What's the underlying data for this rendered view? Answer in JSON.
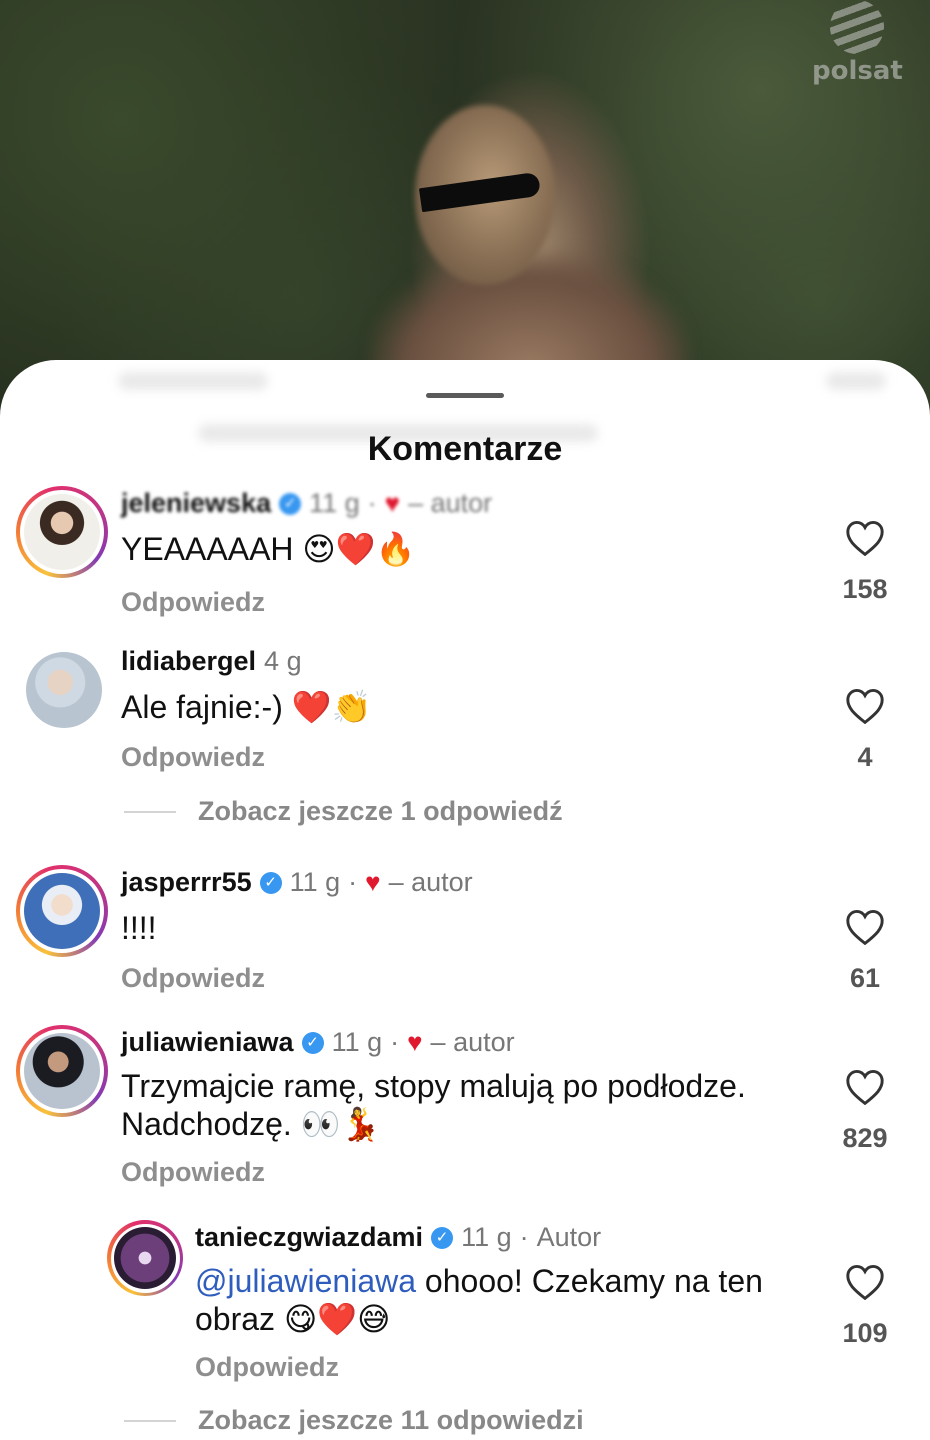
{
  "background": {
    "logo_text": "polsat"
  },
  "sheet": {
    "title": "Komentarze"
  },
  "comments": [
    {
      "username": "jeleniewska",
      "verified": true,
      "time": "11 g",
      "separator": "·",
      "author_tag": "– autor",
      "text": "YEAAAAAH",
      "emojis": "😍❤️🔥",
      "reply_label": "Odpowiedz",
      "likes": "158"
    },
    {
      "username": "lidiabergel",
      "verified": false,
      "time": "4 g",
      "text": "Ale fajnie:-)",
      "emojis": "❤️👏",
      "reply_label": "Odpowiedz",
      "likes": "4",
      "more_replies": "Zobacz jeszcze 1 odpowiedź"
    },
    {
      "username": "jasperrr55",
      "verified": true,
      "time": "11 g",
      "separator": "·",
      "author_tag": "– autor",
      "text": "!!!!",
      "reply_label": "Odpowiedz",
      "likes": "61"
    },
    {
      "username": "juliawieniawa",
      "verified": true,
      "time": "11 g",
      "separator": "·",
      "author_tag": "– autor",
      "text_line1": "Trzymajcie ramę, stopy malują po podłodze.",
      "text_line2": "Nadchodzę.",
      "emojis": "👀💃",
      "reply_label": "Odpowiedz",
      "likes": "829"
    },
    {
      "username": "tanieczgwiazdami",
      "verified": true,
      "time": "11 g",
      "separator": "·",
      "author_tag": "Autor",
      "mention": "@juliawieniawa",
      "text_line1": "ohooo! Czekamy na ten",
      "text_line2": "obraz",
      "emojis": "😋❤️😅",
      "reply_label": "Odpowiedz",
      "likes": "109",
      "more_replies": "Zobacz jeszcze 11 odpowiedzi"
    }
  ],
  "colors": {
    "verified": "#3897f0",
    "heart": "#e0192f",
    "mention": "#2f5dbd"
  }
}
